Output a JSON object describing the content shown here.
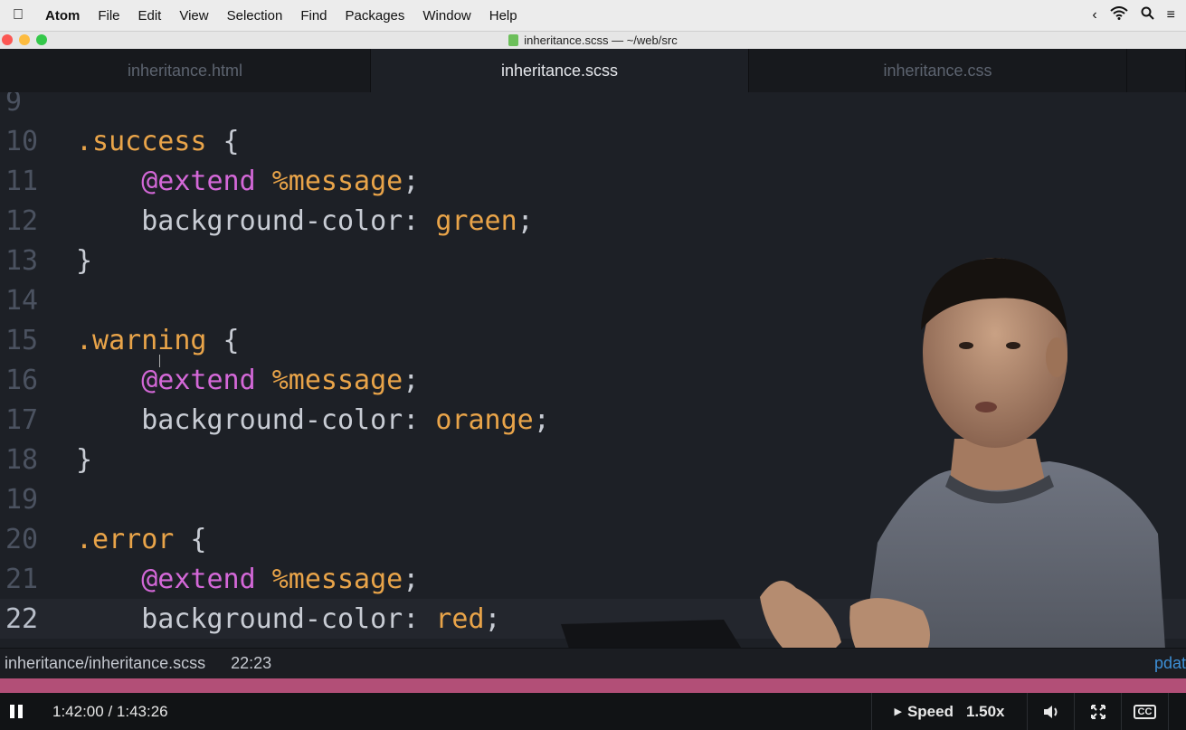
{
  "menubar": {
    "app": "Atom",
    "items": [
      "File",
      "Edit",
      "View",
      "Selection",
      "Find",
      "Packages",
      "Window",
      "Help"
    ],
    "right_icons": [
      "chevron-left-icon",
      "wifi-icon",
      "search-icon",
      "list-icon"
    ]
  },
  "window": {
    "title": "inheritance.scss — ~/web/src"
  },
  "tabs": [
    {
      "label": "inheritance.html",
      "active": false
    },
    {
      "label": "inheritance.scss",
      "active": true
    },
    {
      "label": "inheritance.css",
      "active": false
    }
  ],
  "editor": {
    "lines": [
      {
        "num": "9",
        "tokens": []
      },
      {
        "num": "10",
        "tokens": [
          [
            "c-sel",
            ".success"
          ],
          [
            "c-punc",
            " {"
          ]
        ]
      },
      {
        "num": "11",
        "tokens": [
          [
            "c-punc",
            "    "
          ],
          [
            "c-at",
            "@extend"
          ],
          [
            "c-punc",
            " "
          ],
          [
            "c-ph",
            "%message"
          ],
          [
            "c-punc",
            ";"
          ]
        ]
      },
      {
        "num": "12",
        "tokens": [
          [
            "c-prop",
            "    background-color: "
          ],
          [
            "c-val",
            "green"
          ],
          [
            "c-punc",
            ";"
          ]
        ]
      },
      {
        "num": "13",
        "tokens": [
          [
            "c-punc",
            "}"
          ]
        ]
      },
      {
        "num": "14",
        "tokens": []
      },
      {
        "num": "15",
        "tokens": [
          [
            "c-sel",
            ".warning"
          ],
          [
            "c-punc",
            " {"
          ]
        ]
      },
      {
        "num": "16",
        "tokens": [
          [
            "c-punc",
            "    "
          ],
          [
            "c-at",
            "@extend"
          ],
          [
            "c-punc",
            " "
          ],
          [
            "c-ph",
            "%message"
          ],
          [
            "c-punc",
            ";"
          ]
        ]
      },
      {
        "num": "17",
        "tokens": [
          [
            "c-prop",
            "    background-color: "
          ],
          [
            "c-val",
            "orange"
          ],
          [
            "c-punc",
            ";"
          ]
        ]
      },
      {
        "num": "18",
        "tokens": [
          [
            "c-punc",
            "}"
          ]
        ]
      },
      {
        "num": "19",
        "tokens": []
      },
      {
        "num": "20",
        "tokens": [
          [
            "c-sel",
            ".error"
          ],
          [
            "c-punc",
            " {"
          ]
        ]
      },
      {
        "num": "21",
        "tokens": [
          [
            "c-punc",
            "    "
          ],
          [
            "c-at",
            "@extend"
          ],
          [
            "c-punc",
            " "
          ],
          [
            "c-ph",
            "%message"
          ],
          [
            "c-punc",
            ";"
          ]
        ]
      },
      {
        "num": "22",
        "tokens": [
          [
            "c-prop",
            "    background-color: "
          ],
          [
            "c-val",
            "red"
          ],
          [
            "c-punc",
            ";"
          ]
        ],
        "cursor": true
      }
    ]
  },
  "statusbar": {
    "path": "inheritance/inheritance.scss",
    "cursor_pos": "22:23",
    "update": "pdat"
  },
  "player": {
    "time": "1:42:00 / 1:43:26",
    "speed_label": "Speed",
    "speed_value": "1.50x",
    "progress": 0.986
  },
  "colors": {
    "editor_bg": "#1d2026",
    "selector": "#e9a449",
    "at_rule": "#d468d8",
    "progress": "#b24f77"
  }
}
